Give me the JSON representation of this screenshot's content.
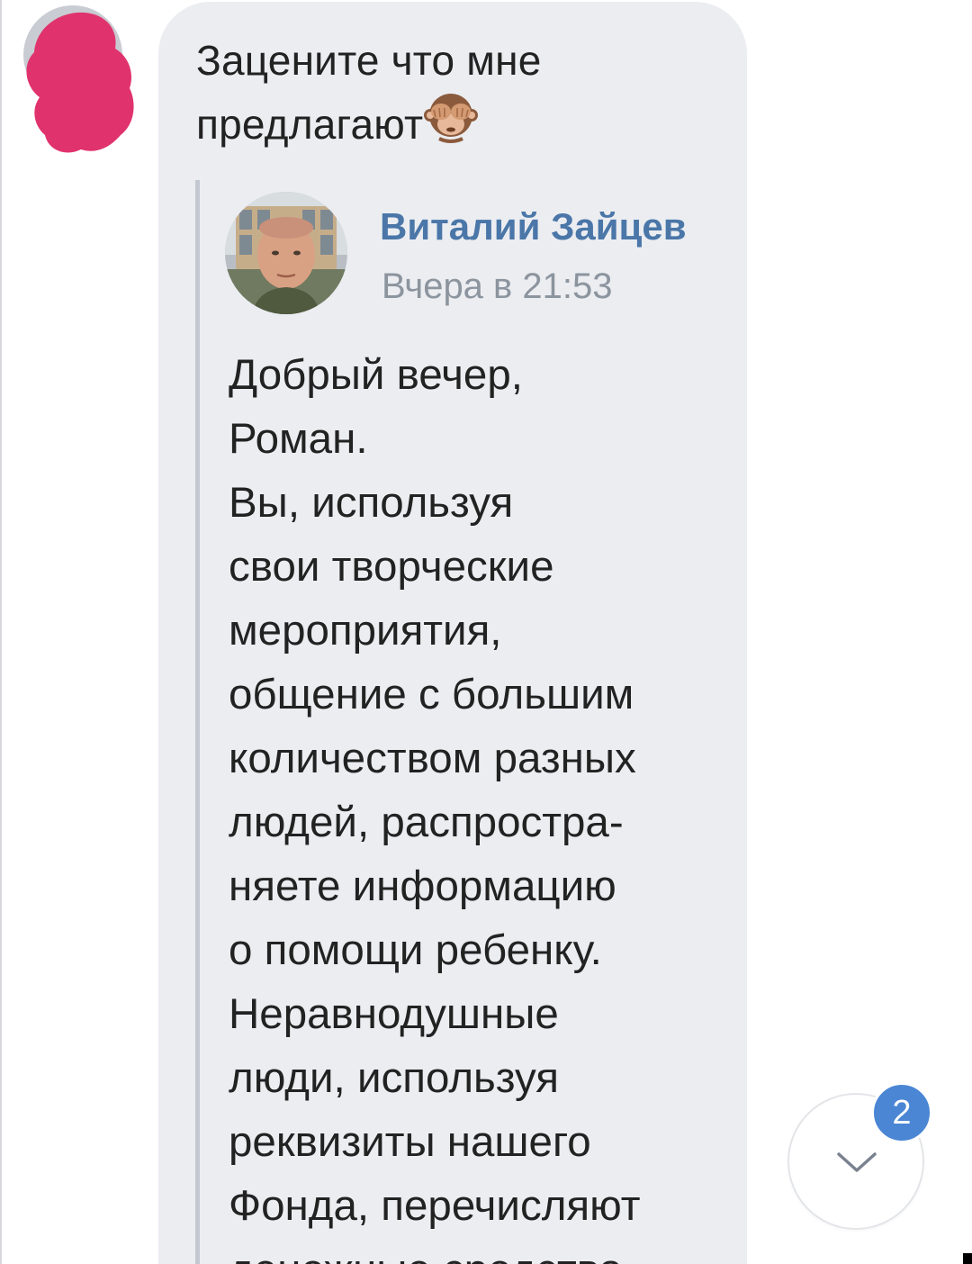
{
  "sender": {
    "avatar_icon": "redacted-avatar",
    "redaction_color": "#e0336d"
  },
  "message": {
    "text": "Зацените что мне предлагают",
    "emoji": "see-no-evil-monkey-icon"
  },
  "quoted_message": {
    "author": "Виталий Зайцев",
    "time": "Вчера в 21:53",
    "text_lines": [
      "Добрый вечер,",
      "Роман.",
      "Вы, используя",
      "свои творческие",
      "мероприятия,",
      "общение с большим",
      "количеством разных",
      "людей, распростра-",
      "няете информацию",
      "о помощи ребенку.",
      "Неравнодушные",
      "люди, используя",
      "реквизиты нашего",
      "Фонда, перечисляют",
      "денежные средства"
    ],
    "author_color": "#4a76a8",
    "time_color": "#8c949e"
  },
  "scroll_down": {
    "icon": "chevron-down-icon",
    "unread_count": "2",
    "badge_color": "#4a86d4"
  },
  "colors": {
    "bubble": "#ebedf1",
    "quote_bar": "#c3c8d0",
    "text": "#222222"
  }
}
